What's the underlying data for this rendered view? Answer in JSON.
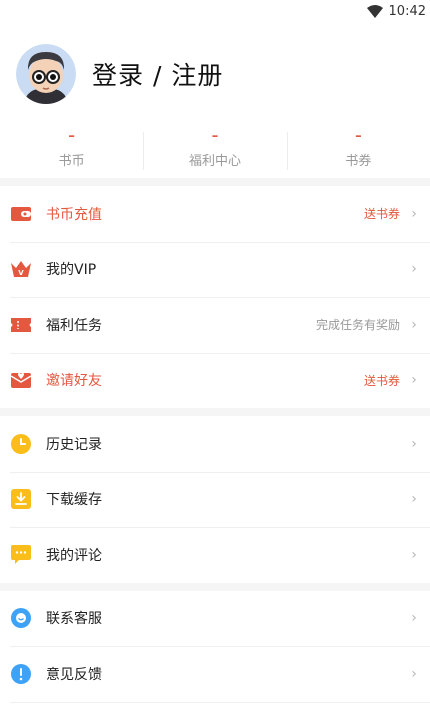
{
  "status": {
    "time": "10:42"
  },
  "profile": {
    "login_label": "登录 / 注册"
  },
  "stats": [
    {
      "value": "–",
      "label": "书币"
    },
    {
      "value": "–",
      "label": "福利中心"
    },
    {
      "value": "–",
      "label": "书券"
    }
  ],
  "sections": [
    [
      {
        "label": "书币充值",
        "extra": "送书券",
        "icon": "wallet-icon",
        "red": true
      },
      {
        "label": "我的VIP",
        "extra": "",
        "icon": "vip-crown-icon",
        "red": false
      },
      {
        "label": "福利任务",
        "extra": "完成任务有奖励",
        "icon": "ticket-icon",
        "red": false
      },
      {
        "label": "邀请好友",
        "extra": "送书券",
        "icon": "invite-envelope-icon",
        "red": true
      }
    ],
    [
      {
        "label": "历史记录",
        "extra": "",
        "icon": "clock-icon",
        "red": false
      },
      {
        "label": "下载缓存",
        "extra": "",
        "icon": "download-icon",
        "red": false
      },
      {
        "label": "我的评论",
        "extra": "",
        "icon": "comment-icon",
        "red": false
      }
    ],
    [
      {
        "label": "联系客服",
        "extra": "",
        "icon": "customer-service-icon",
        "red": false
      },
      {
        "label": "意见反馈",
        "extra": "",
        "icon": "feedback-icon",
        "red": false
      }
    ]
  ],
  "colors": {
    "accent": "#e4583f",
    "yellow": "#fbbd1a",
    "blue": "#3ea3f7"
  },
  "chevron": "›"
}
